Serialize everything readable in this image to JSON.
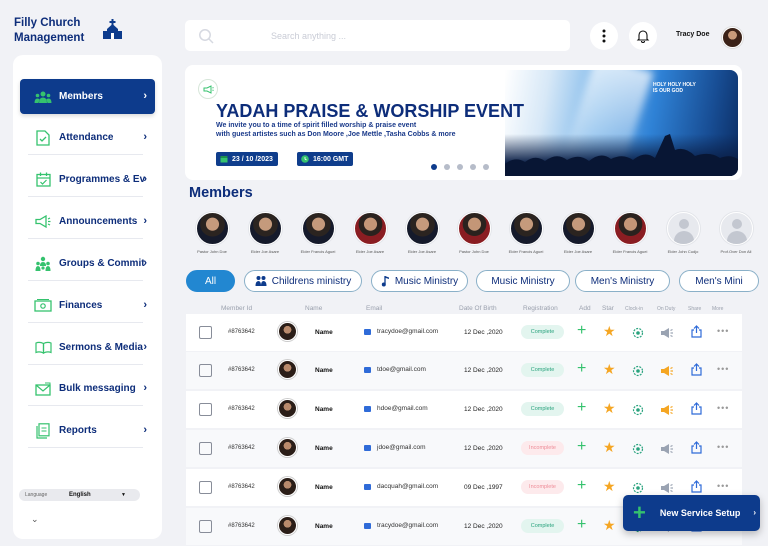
{
  "brand": {
    "line1": "Filly Church",
    "line2": "Management"
  },
  "sidebar": {
    "items": [
      {
        "label": "Members",
        "icon": "members-icon",
        "active": true
      },
      {
        "label": "Attendance",
        "icon": "attendance-icon"
      },
      {
        "label": "Programmes & Eve...",
        "icon": "calendar-icon"
      },
      {
        "label": "Announcements",
        "icon": "megaphone-icon"
      },
      {
        "label": "Groups & Committ...",
        "icon": "groups-icon"
      },
      {
        "label": "Finances",
        "icon": "money-icon"
      },
      {
        "label": "Sermons & Media",
        "icon": "book-icon"
      },
      {
        "label": "Bulk messaging",
        "icon": "mail-icon"
      },
      {
        "label": "Reports",
        "icon": "reports-icon"
      }
    ],
    "language": {
      "label": "Language",
      "value": "English"
    }
  },
  "header": {
    "search_placeholder": "Search anything ...",
    "user_name": "Tracy Doe"
  },
  "banner": {
    "title": "YADAH PRAISE & WORSHIP EVENT",
    "desc_line1": "We invite you to a time of spirit filled worship & praise event",
    "desc_line2": "with guest artistes such as Don Moore ,Joe Mettle ,Tasha Cobbs & more",
    "date": "23 / 10 /2023",
    "time": "16:00 GMT",
    "image_sign_line1": "HOLY HOLY HOLY",
    "image_sign_line2": "IS OUR GOD"
  },
  "members_title": "Members",
  "member_cards": [
    {
      "name": "Pastor John Doe",
      "style": "dark"
    },
    {
      "name": "Elder Joe Asare",
      "style": "dark"
    },
    {
      "name": "Elder Francis Aguei",
      "style": "dark"
    },
    {
      "name": "Elder Joe Asare",
      "style": "red"
    },
    {
      "name": "Elder Joe Asare",
      "style": "dark"
    },
    {
      "name": "Pastor John Doe",
      "style": "red"
    },
    {
      "name": "Elder Francis Aguei",
      "style": "dark"
    },
    {
      "name": "Elder Joe Asare",
      "style": "dark"
    },
    {
      "name": "Elder Francis Aguei",
      "style": "red"
    },
    {
      "name": "Elder John Cudjo",
      "style": "placeholder"
    },
    {
      "name": "Prof.Over Don Ali",
      "style": "placeholder"
    }
  ],
  "filters": [
    {
      "label": "All",
      "active": true
    },
    {
      "label": "Childrens ministry",
      "icon": "children-icon"
    },
    {
      "label": "Music Ministry",
      "icon": "music-note-icon"
    },
    {
      "label": "Music Ministry"
    },
    {
      "label": "Men's Ministry"
    },
    {
      "label": "Men's Mini"
    }
  ],
  "table": {
    "headers": [
      "Member Id",
      "Name",
      "Email",
      "Date Of Birth",
      "Registration",
      "Add",
      "Star",
      "Clock-in",
      "On Duty",
      "Share",
      "More"
    ],
    "rows": [
      {
        "id": "#8763642",
        "name": "Name",
        "email": "tracydoe@gmail.com",
        "dob": "12 Dec ,2020",
        "registration": "Complete",
        "status": "ok",
        "duty_active": false
      },
      {
        "id": "#8763642",
        "name": "Name",
        "email": "tdoe@gmail.com",
        "dob": "12 Dec ,2020",
        "registration": "Complete",
        "status": "ok",
        "duty_active": true
      },
      {
        "id": "#8763642",
        "name": "Name",
        "email": "hdoe@gmail.com",
        "dob": "12 Dec ,2020",
        "registration": "Complete",
        "status": "ok",
        "duty_active": true
      },
      {
        "id": "#8763642",
        "name": "Name",
        "email": "jdoe@gmail.com",
        "dob": "12 Dec ,2020",
        "registration": "Incomplete",
        "status": "bad",
        "duty_active": false
      },
      {
        "id": "#8763642",
        "name": "Name",
        "email": "dacquah@gmail.com",
        "dob": "09 Dec ,1997",
        "registration": "Incomplete",
        "status": "bad",
        "duty_active": false
      },
      {
        "id": "#8763642",
        "name": "Name",
        "email": "tracydoe@gmail.com",
        "dob": "12 Dec ,2020",
        "registration": "Complete",
        "status": "ok",
        "duty_active": false
      }
    ]
  },
  "cta": {
    "label": "New Service Setup"
  },
  "colors": {
    "primary": "#0d3b8c",
    "accent_green": "#35c26e",
    "star": "#f5a623",
    "pill_blue": "#2287d1"
  }
}
